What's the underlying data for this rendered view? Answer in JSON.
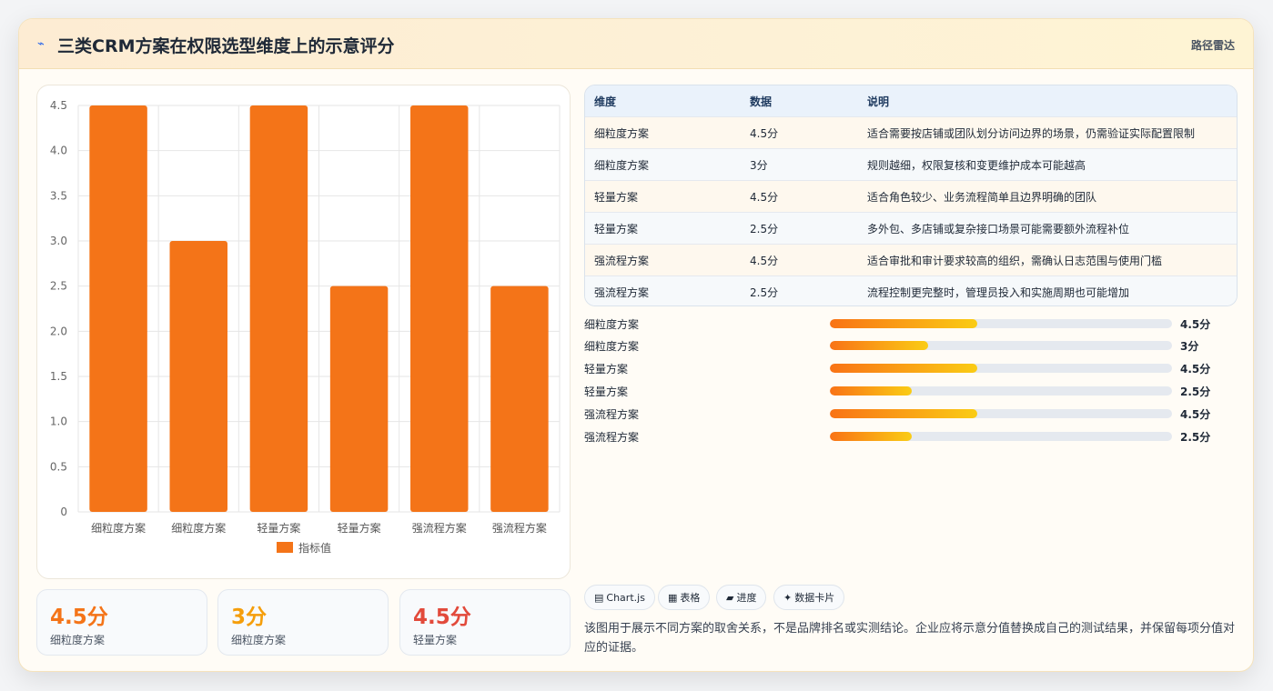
{
  "header": {
    "icon": "lightning-icon",
    "title": "三类CRM方案在权限选型维度上的示意评分",
    "tag": "路径雷达"
  },
  "chart_data": {
    "type": "bar",
    "categories": [
      "细粒度方案",
      "细粒度方案",
      "轻量方案",
      "轻量方案",
      "强流程方案",
      "强流程方案"
    ],
    "series": [
      {
        "name": "指标值",
        "values": [
          4.5,
          3,
          4.5,
          2.5,
          4.5,
          2.5
        ]
      }
    ],
    "ylim": [
      0,
      4.5
    ],
    "yticks": [
      "0",
      "0.5",
      "1.0",
      "1.5",
      "2.0",
      "2.5",
      "3.0",
      "3.5",
      "4.0",
      "4.5"
    ],
    "grid": true,
    "legend": "bottom",
    "color": "#f47418"
  },
  "kpis": [
    {
      "value": "4.5分",
      "label": "细粒度方案",
      "color": "#f47418"
    },
    {
      "value": "3分",
      "label": "细粒度方案",
      "color": "#f59e0b"
    },
    {
      "value": "4.5分",
      "label": "轻量方案",
      "color": "#e24a3b"
    }
  ],
  "table": {
    "headers": [
      "维度",
      "数据",
      "说明"
    ],
    "rows": [
      [
        "细粒度方案",
        "4.5分",
        "适合需要按店铺或团队划分访问边界的场景，仍需验证实际配置限制"
      ],
      [
        "细粒度方案",
        "3分",
        "规则越细，权限复核和变更维护成本可能越高"
      ],
      [
        "轻量方案",
        "4.5分",
        "适合角色较少、业务流程简单且边界明确的团队"
      ],
      [
        "轻量方案",
        "2.5分",
        "多外包、多店铺或复杂接口场景可能需要额外流程补位"
      ],
      [
        "强流程方案",
        "4.5分",
        "适合审批和审计要求较高的组织，需确认日志范围与使用门槛"
      ],
      [
        "强流程方案",
        "2.5分",
        "流程控制更完整时，管理员投入和实施周期也可能增加"
      ]
    ]
  },
  "progress": [
    {
      "label": "细粒度方案",
      "value": "4.5分",
      "fraction": 0.43
    },
    {
      "label": "细粒度方案",
      "value": "3分",
      "fraction": 0.287
    },
    {
      "label": "轻量方案",
      "value": "4.5分",
      "fraction": 0.43
    },
    {
      "label": "轻量方案",
      "value": "2.5分",
      "fraction": 0.239
    },
    {
      "label": "强流程方案",
      "value": "4.5分",
      "fraction": 0.43
    },
    {
      "label": "强流程方案",
      "value": "2.5分",
      "fraction": 0.239
    }
  ],
  "chips": [
    {
      "icon": "chart-icon",
      "glyph": "▤",
      "label": "Chart.js"
    },
    {
      "icon": "table-icon",
      "glyph": "▦",
      "label": "表格"
    },
    {
      "icon": "progress-icon",
      "glyph": "▰",
      "label": "进度"
    },
    {
      "icon": "card-icon",
      "glyph": "✦",
      "label": "数据卡片"
    }
  ],
  "note": "该图用于展示不同方案的取舍关系，不是品牌排名或实测结论。企业应将示意分值替换成自己的测试结果，并保留每项分值对应的证据。"
}
